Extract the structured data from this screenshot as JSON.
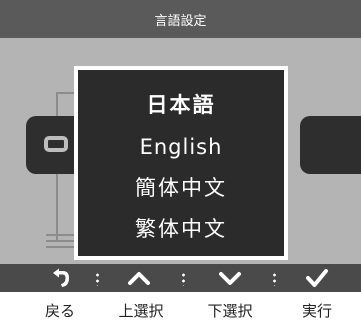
{
  "title": "言語設定",
  "languages": [
    "日本語",
    "English",
    "簡体中文",
    "繁体中文"
  ],
  "selected_index": 0,
  "buttons": {
    "back": "戻る",
    "up": "上選択",
    "down": "下選択",
    "execute": "実行"
  },
  "icons": {
    "back": "return-arrow-icon",
    "up": "chevron-up-icon",
    "down": "chevron-down-icon",
    "execute": "checkmark-icon"
  },
  "colors": {
    "title_bar": "#5a5a5a",
    "screen_bg": "#b4b4b4",
    "dialog_bg": "#2b2b2b",
    "control_bar": "#4a4a4a"
  }
}
